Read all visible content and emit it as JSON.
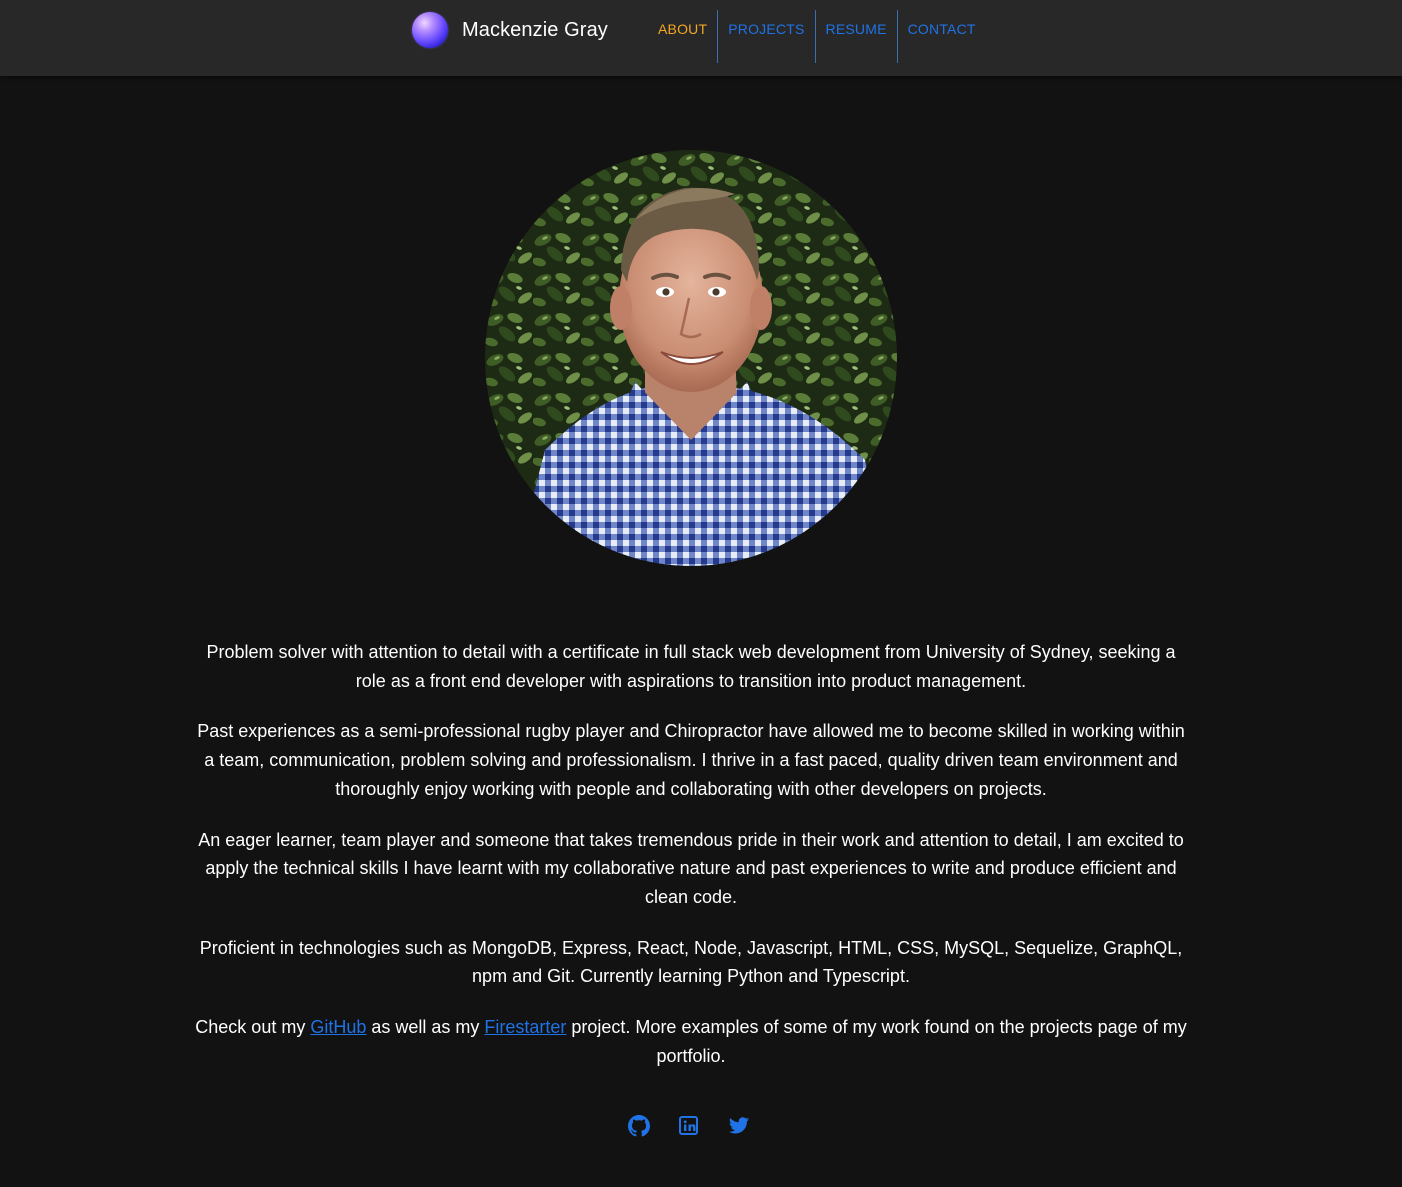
{
  "header": {
    "brand_name": "Mackenzie Gray",
    "nav": [
      {
        "label": "ABOUT",
        "active": true
      },
      {
        "label": "PROJECTS",
        "active": false
      },
      {
        "label": "RESUME",
        "active": false
      },
      {
        "label": "CONTACT",
        "active": false
      }
    ]
  },
  "profile_photo": {
    "icon": "profile-portrait"
  },
  "bio": {
    "p1": "Problem solver with attention to detail with a certificate in full stack web development from University of Sydney, seeking a role as a front end developer with aspirations to transition into product management.",
    "p2": "Past experiences as a semi-professional rugby player and Chiropractor have allowed me to become skilled in working within a team, communication, problem solving and professionalism. I thrive in a fast paced, quality driven team environment and thoroughly enjoy working with people and collaborating with other developers on projects.",
    "p3": "An eager learner, team player and someone that takes tremendous pride in their work and attention to detail, I am excited to apply the technical skills I have learnt with my collaborative nature and past experiences to write and produce efficient and clean code.",
    "p4": "Proficient in technologies such as MongoDB, Express, React, Node, Javascript, HTML, CSS, MySQL, Sequelize, GraphQL, npm and Git. Currently learning Python and Typescript.",
    "p5_before": "Check out my ",
    "p5_link1": "GitHub",
    "p5_middle": " as well as my ",
    "p5_link2": "Firestarter",
    "p5_after": " project. More examples of some of my work found on the projects page of my portfolio."
  },
  "social": [
    {
      "icon": "github-icon"
    },
    {
      "icon": "linkedin-icon"
    },
    {
      "icon": "twitter-icon"
    }
  ],
  "colors": {
    "background": "#121212",
    "header": "#282828",
    "link": "#1f73e6",
    "active_nav": "#f5a623"
  }
}
